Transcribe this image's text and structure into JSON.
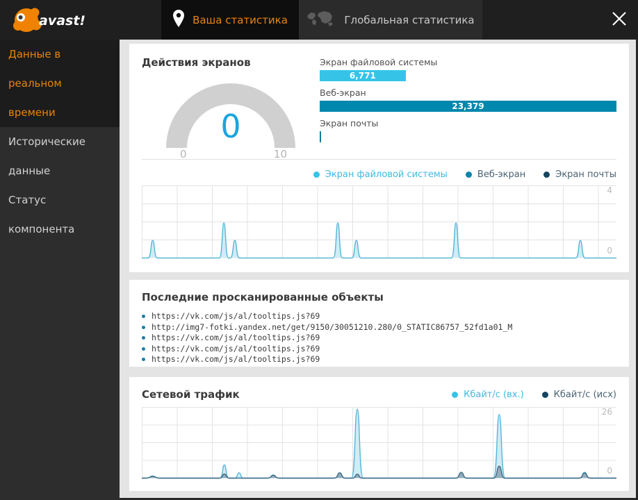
{
  "app": {
    "logo_text": "avast!"
  },
  "tabs": [
    {
      "label": "Ваша статистика",
      "active": true
    },
    {
      "label": "Глобальная статистика",
      "active": false
    }
  ],
  "sidebar": {
    "items": [
      {
        "label": "Данные в реальном времени",
        "active": true
      },
      {
        "label": "Исторические данные",
        "active": false
      },
      {
        "label": "Статус компонента",
        "active": false
      }
    ]
  },
  "screens_panel": {
    "title": "Действия экранов",
    "gauge": {
      "value": "0",
      "min": "0",
      "max": "10"
    },
    "bars": [
      {
        "label": "Экран файловой системы",
        "value": "6,771",
        "num": 6771,
        "color": "#35c4e8"
      },
      {
        "label": "Веб-экран",
        "value": "23,379",
        "num": 23379,
        "color": "#0087ad"
      },
      {
        "label": "Экран почты",
        "value": "",
        "num": 35,
        "color": "#147b9d"
      }
    ],
    "legend": [
      {
        "label": "Экран файловой системы",
        "dot": "#35c4e8",
        "text": "#3fb9de"
      },
      {
        "label": "Веб-экран",
        "dot": "#0f84a9",
        "text": "#4a6272"
      },
      {
        "label": "Экран почты",
        "dot": "#16455f",
        "text": "#4a6272"
      }
    ]
  },
  "scanned_panel": {
    "title": "Последние просканированные объекты",
    "items": [
      "https://vk.com/js/al/tooltips.js?69",
      "http://img7-fotki.yandex.net/get/9150/30051210.280/0_STATIC86757_52fd1a01_M",
      "https://vk.com/js/al/tooltips.js?69",
      "https://vk.com/js/al/tooltips.js?69",
      "https://vk.com/js/al/tooltips.js?69"
    ]
  },
  "network_panel": {
    "title": "Сетевой трафик",
    "legend": [
      {
        "label": "Кбайт/с (вх.)",
        "dot": "#35c4e8",
        "text": "#3fb9de"
      },
      {
        "label": "Кбайт/с (исх)",
        "dot": "#16455f",
        "text": "#4a6272"
      }
    ]
  },
  "chart_data": [
    {
      "type": "area",
      "title": "Действия экранов — активность во времени",
      "ylim": [
        0,
        4
      ],
      "ylabel_top": "4",
      "ylabel_bottom": "0",
      "grid": true,
      "x_unit": "percent-of-width (no x tick labels shown)",
      "series": [
        {
          "name": "Экран файловой системы",
          "color": "#54b7d8",
          "fill": "#cde9f4",
          "spikes": [
            {
              "x": 2.3,
              "h": 1
            },
            {
              "x": 17.3,
              "h": 2
            },
            {
              "x": 19.6,
              "h": 1
            },
            {
              "x": 41.3,
              "h": 2
            },
            {
              "x": 45.2,
              "h": 1
            },
            {
              "x": 66.2,
              "h": 2
            },
            {
              "x": 92.4,
              "h": 1
            }
          ]
        }
      ]
    },
    {
      "type": "area",
      "title": "Сетевой трафик",
      "ylim": [
        0,
        26
      ],
      "ylabel_top": "26",
      "ylabel_bottom": "0",
      "grid": true,
      "x_unit": "percent-of-width (no x tick labels shown)",
      "series": [
        {
          "name": "Кбайт/с (вх.)",
          "color": "#54b7d8",
          "fill": "#cde9f4",
          "spikes": [
            {
              "x": 2.3,
              "h": 0.8,
              "w": 10
            },
            {
              "x": 17.4,
              "h": 5
            },
            {
              "x": 20.5,
              "h": 2
            },
            {
              "x": 27.7,
              "h": 1.2,
              "w": 8
            },
            {
              "x": 41.7,
              "h": 1,
              "w": 8
            },
            {
              "x": 45.4,
              "h": 26,
              "w": 8.5
            },
            {
              "x": 67.3,
              "h": 1.5,
              "w": 8
            },
            {
              "x": 75.3,
              "h": 24,
              "w": 8.5
            },
            {
              "x": 93.3,
              "h": 2.2,
              "w": 8
            }
          ]
        },
        {
          "name": "Кбайт/с (исх)",
          "color": "#3e6b85",
          "fill": "#8fa8b8",
          "spikes": [
            {
              "x": 2.3,
              "h": 0.7,
              "w": 10
            },
            {
              "x": 17.4,
              "h": 1.6,
              "w": 7
            },
            {
              "x": 27.7,
              "h": 1.1,
              "w": 8
            },
            {
              "x": 41.7,
              "h": 2,
              "w": 8
            },
            {
              "x": 45.4,
              "h": 1.5,
              "w": 7
            },
            {
              "x": 67.3,
              "h": 2.2,
              "w": 8
            },
            {
              "x": 75.3,
              "h": 4.5,
              "w": 8
            },
            {
              "x": 93.3,
              "h": 1.9,
              "w": 8
            }
          ]
        }
      ]
    }
  ]
}
